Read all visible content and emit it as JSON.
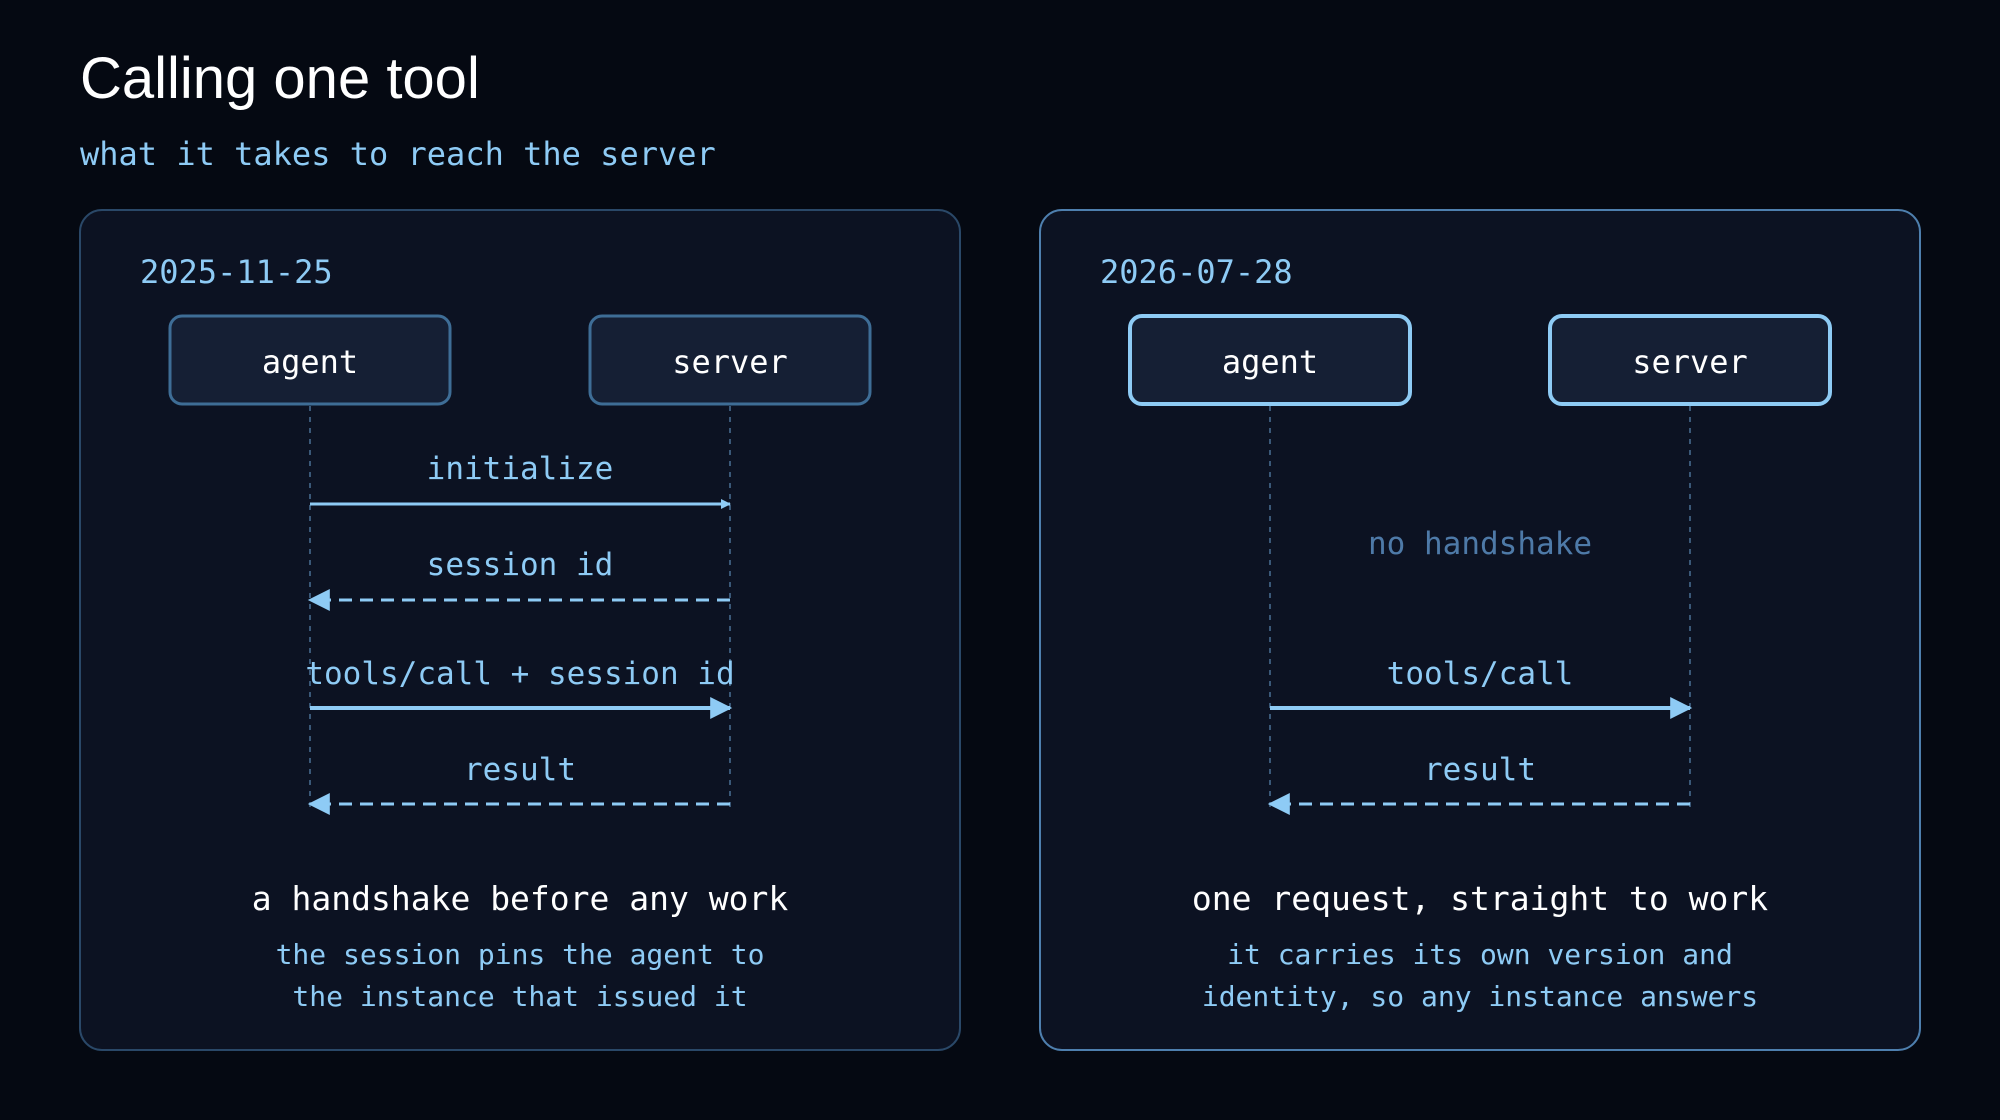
{
  "title": "Calling one tool",
  "subtitle": "what it takes to reach the server",
  "colors": {
    "background": "#050912",
    "panel": "#0c1222",
    "panel_border_old": "#2a4868",
    "panel_border_new": "#4e7fae",
    "box_fill": "#151f34",
    "box_border_old": "#3e6d96",
    "box_border_new": "#8ecbf5",
    "accent": "#8ecbf5",
    "muted": "#4e7aa8",
    "text": "#ffffff"
  },
  "panels": [
    {
      "date": "2025-11-25",
      "agent_label": "agent",
      "server_label": "server",
      "messages": [
        {
          "label": "initialize",
          "direction": "to-server",
          "style": "solid"
        },
        {
          "label": "session id",
          "direction": "to-agent",
          "style": "dashed"
        },
        {
          "label": "tools/call + session id",
          "direction": "to-server",
          "style": "solid"
        },
        {
          "label": "result",
          "direction": "to-agent",
          "style": "dashed"
        }
      ],
      "caption": "a handshake before any work",
      "note_lines": [
        "the session pins the agent to",
        "the instance that issued it"
      ]
    },
    {
      "date": "2026-07-28",
      "agent_label": "agent",
      "server_label": "server",
      "gap_note": "no handshake",
      "messages": [
        {
          "label": "tools/call",
          "direction": "to-server",
          "style": "solid"
        },
        {
          "label": "result",
          "direction": "to-agent",
          "style": "dashed"
        }
      ],
      "caption": "one request, straight to work",
      "note_lines": [
        "it carries its own version and",
        "identity, so any instance answers"
      ]
    }
  ]
}
